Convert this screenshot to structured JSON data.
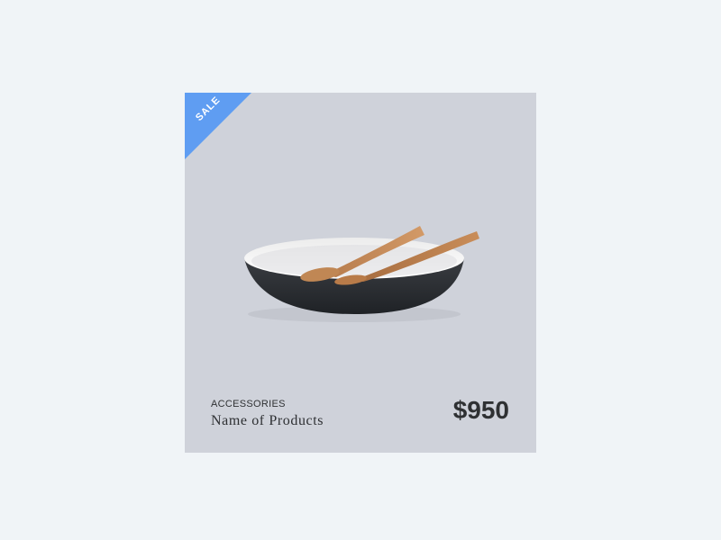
{
  "card": {
    "badge": "SALE",
    "category": "ACCESSORIES",
    "product_name": "Name of Products",
    "price": "$950",
    "accent_color": "#5f9df2",
    "background_color": "#cfd2da"
  }
}
